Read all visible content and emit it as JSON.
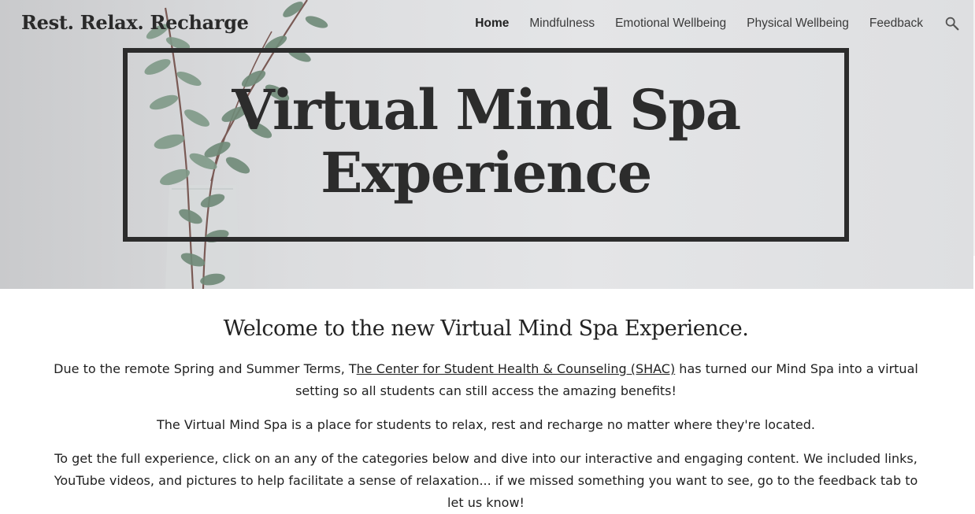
{
  "header": {
    "site_title": "Rest. Relax. Recharge",
    "nav": [
      {
        "label": "Home",
        "active": true
      },
      {
        "label": "Mindfulness",
        "active": false
      },
      {
        "label": "Emotional Wellbeing",
        "active": false
      },
      {
        "label": "Physical Wellbeing",
        "active": false
      },
      {
        "label": "Feedback",
        "active": false
      }
    ],
    "search_icon": "search-icon"
  },
  "hero": {
    "title_line1": "Virtual Mind Spa",
    "title_line2": "Experience",
    "background_image": "eucalyptus-plant-in-glass-vase"
  },
  "main": {
    "welcome": "Welcome to the new Virtual Mind Spa Experience.",
    "p1_before": "Due to the remote Spring and Summer Terms, T",
    "p1_link": "he Center for Student Health & Counseling (SHAC)",
    "p1_after": " has turned our Mind Spa into a virtual setting so all students can still access the amazing benefits!",
    "p2": "The Virtual Mind Spa is a place for students to relax, rest and recharge no matter where they're located.",
    "p3": "To get the full experience, click on an any of the categories below and dive into our interactive and engaging content. We included links, YouTube videos, and pictures to help facilitate a sense of relaxation... if we missed something you want to see, go to the feedback tab to let us know!"
  },
  "colors": {
    "text_dark": "#2c2c2c",
    "hero_bg": "#dcdddf",
    "leaf": "#6f8a78"
  }
}
